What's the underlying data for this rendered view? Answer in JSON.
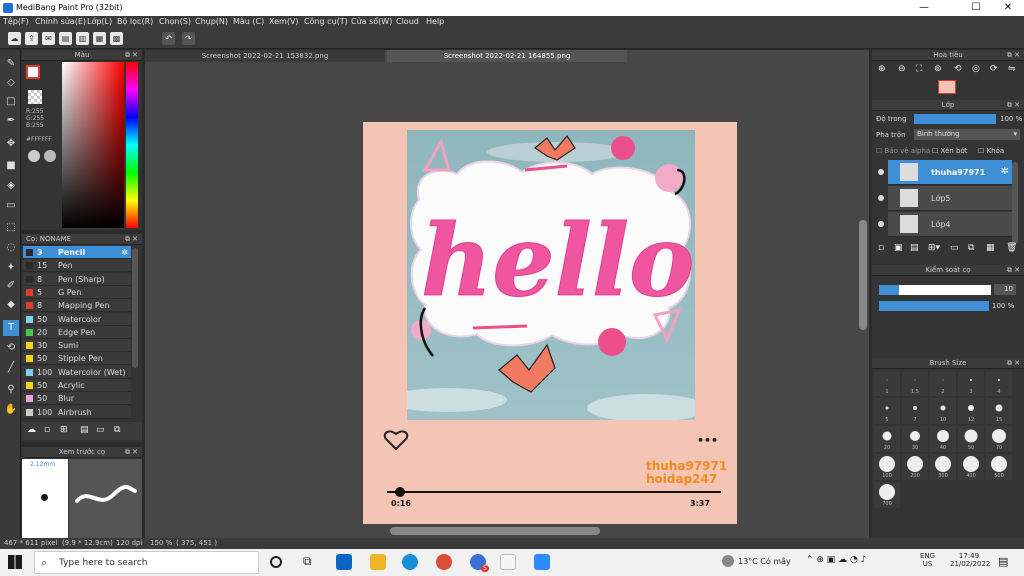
{
  "window": {
    "title": "MediBang Paint Pro (32bit)",
    "min": "—",
    "max": "☐",
    "close": "✕"
  },
  "menu": [
    "Tệp(F)",
    "Chỉnh sửa(E)",
    "Lớp(L)",
    "Bộ lọc(R)",
    "Chọn(S)",
    "Chụp(N)",
    "Màu (C)",
    "Xem(V)",
    "Công cụ(T)",
    "Cửa sổ(W)",
    "Cloud",
    "Help"
  ],
  "color_panel": {
    "title": "Màu",
    "r": "R:255",
    "g": "G:255",
    "b": "B:255",
    "hex": "#FFFFFF"
  },
  "brush_panel": {
    "title": "Cọ: NONAME",
    "items": [
      {
        "num": "3",
        "name": "Pencil",
        "color": "#2a2a2a"
      },
      {
        "num": "15",
        "name": "Pen",
        "color": "#2a2a2a"
      },
      {
        "num": "8",
        "name": "Pen (Sharp)",
        "color": "#2a2a2a"
      },
      {
        "num": "5",
        "name": "G Pen",
        "color": "#e33b2f"
      },
      {
        "num": "8",
        "name": "Mapping Pen",
        "color": "#e33b2f"
      },
      {
        "num": "50",
        "name": "Watercolor",
        "color": "#7fcff0"
      },
      {
        "num": "20",
        "name": "Edge Pen",
        "color": "#46c84b"
      },
      {
        "num": "30",
        "name": "Sumi",
        "color": "#f2d21c"
      },
      {
        "num": "50",
        "name": "Stipple Pen",
        "color": "#f2d21c"
      },
      {
        "num": "100",
        "name": "Watercolor (Wet)",
        "color": "#7fcff0"
      },
      {
        "num": "50",
        "name": "Acrylic",
        "color": "#f2d21c"
      },
      {
        "num": "50",
        "name": "Blur",
        "color": "#f0a0d8"
      },
      {
        "num": "100",
        "name": "Airbrush",
        "color": "#cccccc"
      }
    ]
  },
  "preview": {
    "title": "Xem trước cọ",
    "size": "2.12mm"
  },
  "tabs": [
    "Screenshot 2022-02-21 153832.png",
    "Screenshot 2022-02-21 164855.png"
  ],
  "canvas": {
    "word": "hello",
    "user": "thuha97971",
    "site": "hoidap247",
    "time_start": "0:16",
    "time_end": "3:37",
    "more": "•••",
    "progress": 0.04
  },
  "navigator": {
    "title": "Hoa tiêu"
  },
  "layer_panel": {
    "title": "Lớp",
    "opacity_label": "Độ trong",
    "opacity_value": "100 %",
    "blend_label": "Pha trộn",
    "blend_value": "Bình thường",
    "protect_alpha": "Bảo vệ alpha",
    "clip": "Xén bớt",
    "lock": "Khóa",
    "layers": [
      {
        "name": "thuha97971",
        "selected": true
      },
      {
        "name": "Lớp5",
        "selected": false
      },
      {
        "name": "Lớp4",
        "selected": false
      }
    ]
  },
  "brush_control": {
    "title": "Kiểm soát cọ",
    "size": "10",
    "opacity": "100 %",
    "size_fraction": 0.18,
    "opacity_fraction": 1.0
  },
  "brush_size": {
    "title": "Brush Size",
    "sizes": [
      "1",
      "1.5",
      "2",
      "3",
      "4",
      "5",
      "7",
      "10",
      "12",
      "15",
      "20",
      "30",
      "40",
      "50",
      "70",
      "100",
      "200",
      "300",
      "400",
      "500",
      "700"
    ]
  },
  "status": {
    "dims": "467 * 611 pixel",
    "cm": "(9.9 * 12.9cm)",
    "dpi": "120 dpi",
    "zoom": "150 %",
    "pos": "( 375, 451 )"
  },
  "taskbar": {
    "search": "Type here to search",
    "weather": "13°C Có mây",
    "lang1": "ENG",
    "lang2": "US",
    "time": "17:49",
    "date": "21/02/2022",
    "badge": "5"
  },
  "colors": {
    "accent": "#3f8fd6",
    "canvas_bg": "#f4c4b5",
    "pink": "#f0559f",
    "orange": "#f28a1e"
  }
}
